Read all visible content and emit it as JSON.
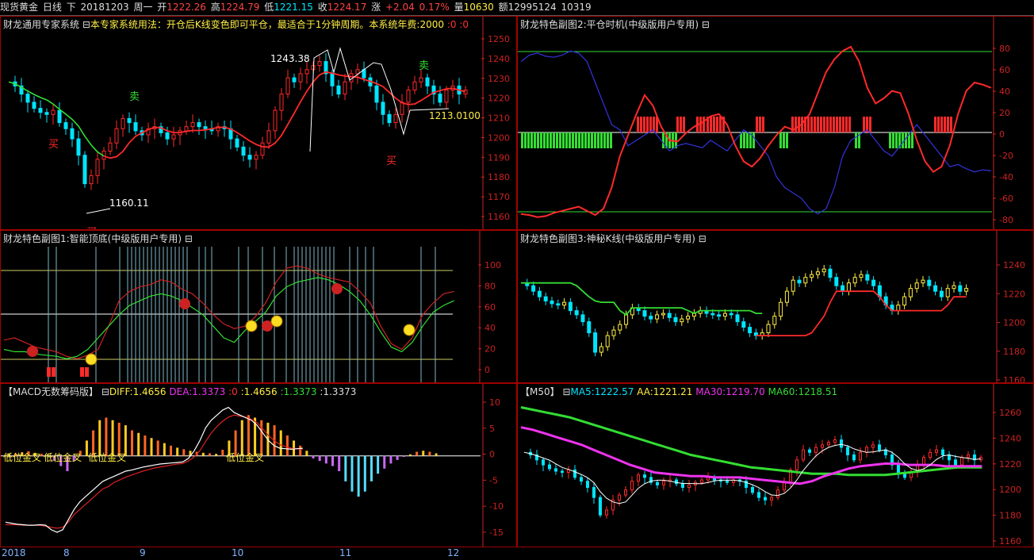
{
  "topbar": {
    "name": "现货黄金",
    "period": "日线",
    "direction": "下",
    "date": "20181203",
    "weekday": "周一",
    "open_label": "开",
    "open": "1222.26",
    "high_label": "高",
    "high": "1224.79",
    "low_label": "低",
    "low": "1221.15",
    "close_label": "收",
    "close": "1224.17",
    "change_label": "涨",
    "change": "+2.04",
    "change_pct": "0.17%",
    "volume_label": "量",
    "volume": "10630",
    "amount_label": "额",
    "amount": "12995124",
    "extra": "10319"
  },
  "colors": {
    "up": "#ff2a2a",
    "down": "#00e5ff",
    "green": "#33dd33",
    "yellow": "#ffee44",
    "magenta": "#ee33ee",
    "axis": "#cc2222",
    "blue": "#3333dd"
  },
  "panel_main": {
    "title_a": "财龙通用专家系统",
    "collapse_icon": "⊟",
    "title_b": "本专家系统用法：开仓后K线变色即可平仓，最适合于1分钟周期。本系统年费:2000",
    "title_c": ":0 :0",
    "label_high": "1243.38",
    "label_low": "1160.11",
    "label_last": "1213.0100",
    "signals": [
      "买",
      "卖",
      "卖",
      "买",
      "买"
    ],
    "axis": [
      "1250",
      "1240",
      "1230",
      "1220",
      "1210",
      "1200",
      "1190",
      "1180",
      "1170",
      "1160"
    ]
  },
  "panel_sub2": {
    "title": "财龙特色副图2:平仓时机(中级版用户专用)",
    "collapse_icon": "⊟",
    "axis": [
      "80",
      "60",
      "40",
      "20",
      "0",
      "-20",
      "-40",
      "-60",
      "-80"
    ]
  },
  "panel_sub1": {
    "title": "财龙特色副图1:智能顶底(中级版用户专用)",
    "collapse_icon": "⊟",
    "axis": [
      "100",
      "80",
      "60",
      "40",
      "20",
      "0"
    ]
  },
  "panel_sub3": {
    "title": "财龙特色副图3:神秘K线(中级版用户专用)",
    "collapse_icon": "⊟",
    "axis": [
      "1240",
      "1220",
      "1200",
      "1180",
      "1160"
    ]
  },
  "panel_macd": {
    "title": "【MACD无数筹码版】",
    "collapse_icon": "⊟",
    "diff_label": "DIFF:1.4656",
    "dea_label": "DEA:1.3373",
    "v1": ":0",
    "v2": ":1.4656",
    "v3": ":1.3373",
    "v4": ":1.3373",
    "annotations": [
      "低位金叉",
      "低位金叉",
      "低位金叉",
      "低位金叉"
    ],
    "axis": [
      "10",
      "5",
      "0",
      "-5",
      "-10",
      "-15"
    ]
  },
  "panel_ma": {
    "title": "【M50】",
    "collapse_icon": "⊟",
    "ma5": "MA5:1222.57",
    "aa": "AA:1221.21",
    "ma30": "MA30:1219.70",
    "ma60": "MA60:1218.51",
    "axis": [
      "1260",
      "1240",
      "1220",
      "1200",
      "1180",
      "1160"
    ]
  },
  "xaxis": [
    "2018",
    "8",
    "9",
    "10",
    "11",
    "12"
  ],
  "chart_data": [
    {
      "type": "candlestick",
      "title": "财龙通用专家系统",
      "ylim": [
        1158,
        1253
      ],
      "annotations": {
        "high": 1243.38,
        "low": 1160.11,
        "last": 1213.01
      },
      "close_series": [
        1228,
        1226,
        1222,
        1218,
        1215,
        1213,
        1212,
        1214,
        1208,
        1205,
        1200,
        1192,
        1178,
        1182,
        1190,
        1194,
        1198,
        1205,
        1210,
        1208,
        1204,
        1202,
        1205,
        1206,
        1203,
        1200,
        1202,
        1204,
        1206,
        1208,
        1206,
        1205,
        1204,
        1206,
        1205,
        1200,
        1196,
        1192,
        1190,
        1192,
        1198,
        1204,
        1214,
        1222,
        1230,
        1228,
        1232,
        1234,
        1236,
        1238,
        1232,
        1226,
        1222,
        1228,
        1232,
        1234,
        1230,
        1226,
        1218,
        1212,
        1208,
        1212,
        1218,
        1224,
        1228,
        1230,
        1226,
        1222,
        1218,
        1224,
        1226,
        1222,
        1224
      ]
    },
    {
      "type": "line",
      "title": "财龙特色副图2:平仓时机(中级版用户专用)",
      "ylim": [
        -85,
        90
      ],
      "series": [
        {
          "values": [
            -75,
            -76,
            -78,
            -77,
            -74,
            -72,
            -70,
            -68,
            -72,
            -76,
            -70,
            -50,
            -20,
            0,
            20,
            38,
            28,
            8,
            -5,
            -6,
            2,
            8,
            12,
            18,
            20,
            10,
            -10,
            -25,
            -30,
            -22,
            -10,
            0,
            8,
            5,
            10,
            20,
            40,
            60,
            72,
            80,
            84,
            70,
            45,
            30,
            35,
            42,
            40,
            20,
            -5,
            -25,
            -35,
            -30,
            -10,
            20,
            42,
            50,
            48,
            45
          ]
        },
        {
          "values": [
            70,
            76,
            78,
            75,
            74,
            76,
            80,
            78,
            70,
            50,
            30,
            10,
            5,
            -10,
            -5,
            0,
            5,
            -5,
            -15,
            -10,
            -8,
            -10,
            -12,
            -5,
            -10,
            -15,
            -5,
            5,
            0,
            -10,
            -20,
            -40,
            -50,
            -55,
            -60,
            -70,
            -75,
            -70,
            -50,
            -20,
            -5,
            0,
            5,
            -5,
            -15,
            -20,
            -10,
            0,
            10,
            0,
            -10,
            -20,
            -30,
            -28,
            -32,
            -35,
            -33,
            -34
          ]
        }
      ]
    },
    {
      "type": "line",
      "title": "财龙特色副图1:智能顶底(中级版用户专用)",
      "ylim": [
        -5,
        110
      ],
      "series": [
        {
          "values": [
            28,
            30,
            26,
            22,
            20,
            18,
            14,
            12,
            15,
            20,
            40,
            62,
            70,
            74,
            76,
            80,
            78,
            72,
            68,
            60,
            50,
            42,
            38,
            40,
            48,
            60,
            78,
            90,
            92,
            90,
            85,
            82,
            80,
            78,
            70,
            60,
            40,
            25,
            20,
            30,
            50,
            60,
            68,
            70
          ]
        },
        {
          "values": [
            20,
            18,
            18,
            16,
            15,
            14,
            12,
            14,
            20,
            30,
            40,
            50,
            58,
            62,
            66,
            68,
            66,
            62,
            56,
            50,
            40,
            30,
            26,
            36,
            44,
            52,
            66,
            74,
            78,
            80,
            82,
            80,
            76,
            70,
            62,
            50,
            35,
            22,
            18,
            26,
            40,
            52,
            58,
            62
          ]
        }
      ]
    },
    {
      "type": "candlestick",
      "title": "财龙特色副图3:神秘K线(中级版用户专用)",
      "ylim": [
        1158,
        1253
      ],
      "close_series": [
        1228,
        1226,
        1222,
        1218,
        1215,
        1213,
        1212,
        1214,
        1208,
        1205,
        1200,
        1192,
        1178,
        1182,
        1190,
        1194,
        1198,
        1205,
        1210,
        1208,
        1204,
        1202,
        1205,
        1206,
        1203,
        1200,
        1202,
        1204,
        1206,
        1208,
        1206,
        1205,
        1204,
        1206,
        1205,
        1200,
        1196,
        1192,
        1190,
        1192,
        1198,
        1204,
        1214,
        1222,
        1230,
        1228,
        1232,
        1234,
        1236,
        1238,
        1232,
        1226,
        1222,
        1228,
        1232,
        1234,
        1230,
        1226,
        1218,
        1212,
        1208,
        1212,
        1218,
        1224,
        1228,
        1230,
        1226,
        1222,
        1218,
        1224,
        1226,
        1222,
        1224
      ]
    },
    {
      "type": "bar",
      "title": "【MACD无数筹码版】",
      "ylim": [
        -17,
        11
      ],
      "values": [
        0.3,
        0.5,
        0.7,
        0.9,
        0.6,
        0.4,
        0.2,
        -1,
        -2,
        -3,
        -1,
        1,
        3,
        5,
        7,
        7.5,
        7,
        6.5,
        6,
        5,
        4.5,
        4,
        3.5,
        3,
        2.5,
        2,
        1.6,
        1.3,
        1,
        0.8,
        0.6,
        0.5,
        0.4,
        1.2,
        3,
        5,
        7,
        8,
        7.5,
        7,
        6.5,
        6,
        5,
        4,
        3,
        2,
        1,
        -0.5,
        -1,
        -1.5,
        -2,
        -3,
        -5,
        -7,
        -8,
        -7,
        -5,
        -3.5,
        -2.5,
        -1.5,
        -0.8,
        -0.2,
        0.3,
        0.8,
        1,
        0.8,
        0.5
      ],
      "series": [
        {
          "name": "DIFF",
          "values": [
            -13,
            -13.2,
            -13.4,
            -13.5,
            -13.6,
            -13.6,
            -13.5,
            -13.6,
            -14.5,
            -15,
            -14.5,
            -12.5,
            -10.5,
            -9,
            -8,
            -7,
            -6,
            -5,
            -4.5,
            -4,
            -3.5,
            -3,
            -2.8,
            -2.5,
            -2.2,
            -2,
            -1.8,
            -1.6,
            -1.5,
            -1.4,
            -1.3,
            -1.2,
            -0.5,
            1,
            3,
            5.5,
            7,
            8,
            9,
            9.5,
            8.5,
            8,
            7.5,
            7,
            6,
            4.5,
            3,
            2,
            1.5,
            1.4,
            1.3,
            1.4,
            1.5
          ]
        },
        {
          "name": "DEA",
          "values": [
            -13.5,
            -13.5,
            -13.5,
            -13.6,
            -13.6,
            -13.6,
            -13.6,
            -13.8,
            -14,
            -14.2,
            -14,
            -13,
            -11.5,
            -10.5,
            -9.5,
            -8.5,
            -7.5,
            -6.5,
            -6,
            -5.2,
            -4.7,
            -4.2,
            -3.8,
            -3.4,
            -3,
            -2.7,
            -2.4,
            -2.2,
            -2,
            -1.8,
            -1.6,
            -1.5,
            -1,
            -0.2,
            1,
            2.8,
            4.5,
            5.8,
            6.8,
            7.6,
            8,
            7.8,
            7.6,
            7.2,
            6.5,
            5.3,
            4,
            3,
            2.2,
            1.8,
            1.5,
            1.4,
            1.34
          ]
        }
      ]
    },
    {
      "type": "line",
      "title": "【M50】",
      "ylim": [
        1158,
        1272
      ],
      "series": [
        {
          "name": "MA5",
          "values": [
            1222.57
          ]
        },
        {
          "name": "AA",
          "values": [
            1221.21
          ]
        },
        {
          "name": "MA30",
          "values": [
            1219.7
          ]
        },
        {
          "name": "MA60",
          "values": [
            1218.51
          ]
        }
      ]
    }
  ]
}
